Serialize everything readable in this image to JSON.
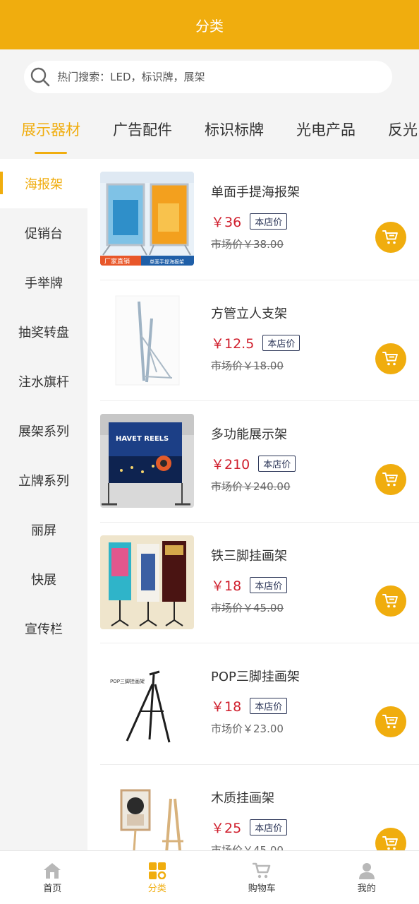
{
  "header": {
    "title": "分类"
  },
  "search": {
    "placeholder": "热门搜索：LED，标识牌，展架"
  },
  "tabs": [
    {
      "label": "展示器材",
      "active": true
    },
    {
      "label": "广告配件"
    },
    {
      "label": "标识标牌"
    },
    {
      "label": "光电产品"
    },
    {
      "label": "反光"
    }
  ],
  "sidebar": {
    "items": [
      {
        "label": "海报架",
        "active": true
      },
      {
        "label": "促销台"
      },
      {
        "label": "手举牌"
      },
      {
        "label": "抽奖转盘"
      },
      {
        "label": "注水旗杆"
      },
      {
        "label": "展架系列"
      },
      {
        "label": "立牌系列"
      },
      {
        "label": "丽屏"
      },
      {
        "label": "快展"
      },
      {
        "label": "宣传栏"
      }
    ]
  },
  "products": [
    {
      "name": "单面手提海报架",
      "price": "￥36",
      "badge": "本店价",
      "market": "市场价￥38.00",
      "strike": true
    },
    {
      "name": "方管立人支架",
      "price": "￥12.5",
      "badge": "本店价",
      "market": "市场价￥18.00",
      "strike": true
    },
    {
      "name": "多功能展示架",
      "price": "￥210",
      "badge": "本店价",
      "market": "市场价￥240.00",
      "strike": true
    },
    {
      "name": "铁三脚挂画架",
      "price": "￥18",
      "badge": "本店价",
      "market": "市场价￥45.00",
      "strike": true
    },
    {
      "name": "POP三脚挂画架",
      "price": "￥18",
      "badge": "本店价",
      "market": "市场价￥23.00",
      "strike": false
    },
    {
      "name": "木质挂画架",
      "price": "￥25",
      "badge": "本店价",
      "market": "市场价￥45.00",
      "strike": true
    }
  ],
  "thumb_text": {
    "p1_banner_left": "厂家直销",
    "p1_banner_right": "单面手提海报架",
    "p3_sign": "HAVET REELS",
    "p5_label": "POP三脚挂画架"
  },
  "tabbar": [
    {
      "label": "首页",
      "icon": "home-icon"
    },
    {
      "label": "分类",
      "icon": "category-icon",
      "active": true
    },
    {
      "label": "购物车",
      "icon": "cart-icon"
    },
    {
      "label": "我的",
      "icon": "user-icon"
    }
  ],
  "colors": {
    "accent": "#f0ad0e",
    "price": "#d0202e",
    "badge": "#2b3557"
  }
}
